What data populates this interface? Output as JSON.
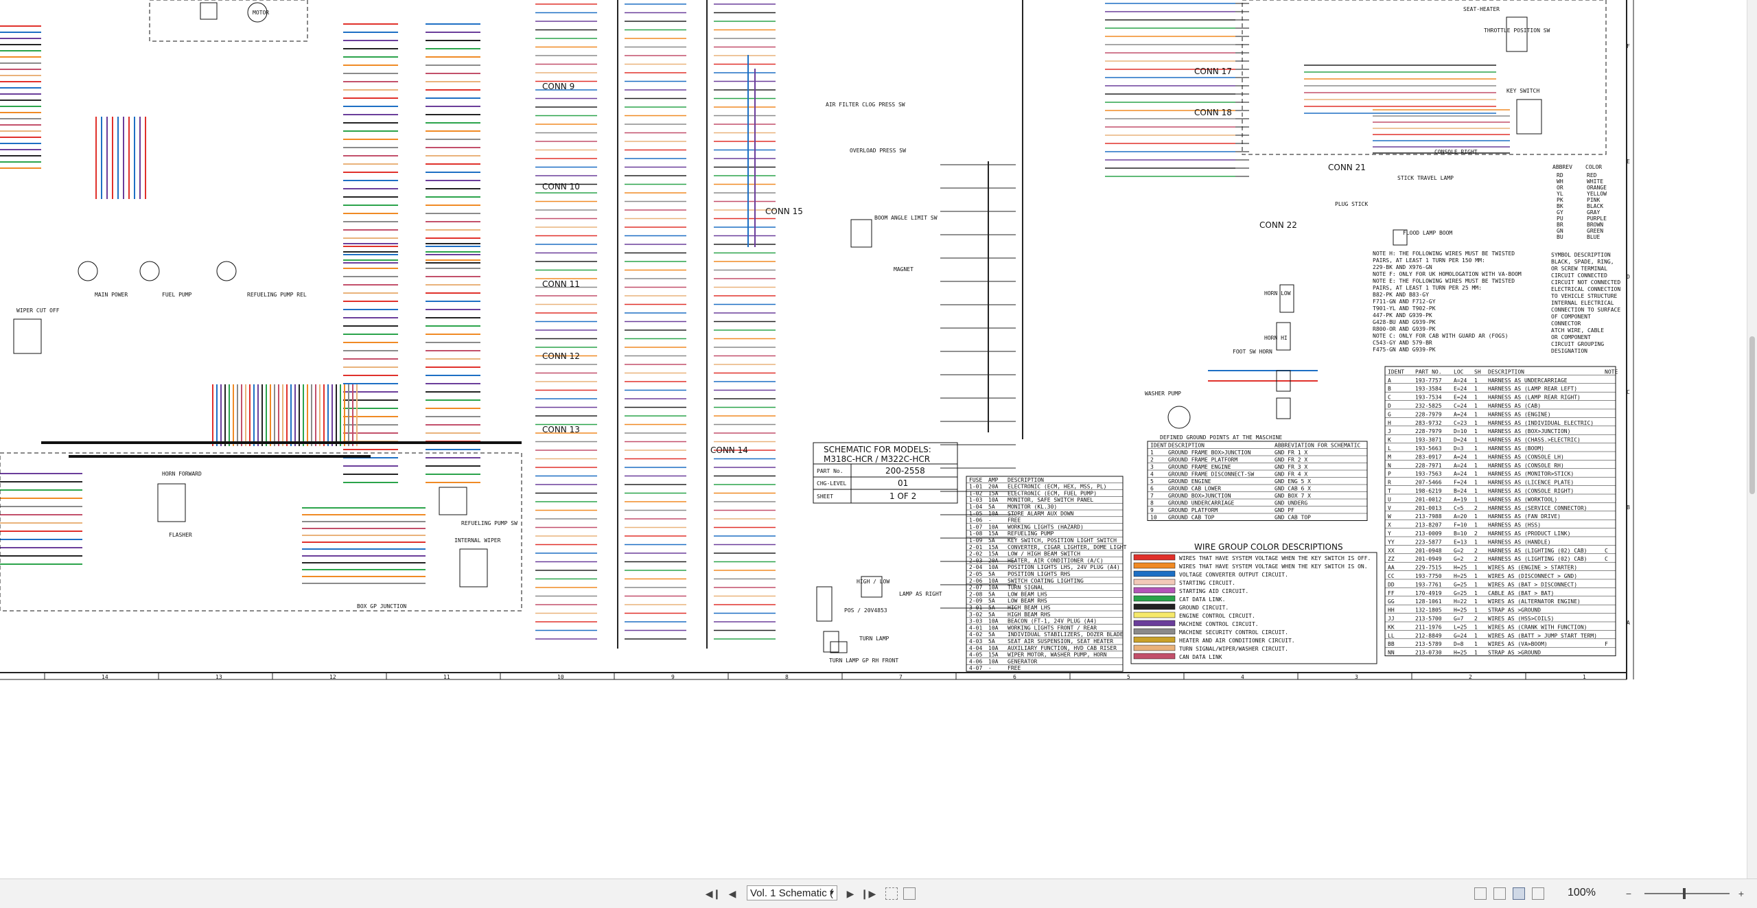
{
  "document": {
    "title_block": {
      "heading_line1": "SCHEMATIC FOR MODELS:",
      "heading_line2": "M318C-HCR / M322C-HCR",
      "part_no_label": "PART No.",
      "part_no": "200-2558",
      "chg_level_label": "CHG-LEVEL",
      "chg_level": "01",
      "sheet_label": "SHEET",
      "sheet": "1 OF 2"
    },
    "connectors": [
      "CONN 9",
      "CONN 10",
      "CONN 11",
      "CONN 12",
      "CONN 13",
      "CONN 14",
      "CONN 15",
      "CONN 17",
      "CONN 18",
      "CONN 21",
      "CONN 22"
    ],
    "component_labels": {
      "motor": "MOTOR",
      "seat_heater": "SEAT-HEATER",
      "console_right": "CONSOLE RIGHT",
      "key_switch": "KEY SWITCH",
      "throttle": "THROTTLE POSITION SW",
      "air_filter": "AIR FILTER CLOG PRESS SW",
      "overload": "OVERLOAD PRESS SW",
      "boom_angle": "BOOM ANGLE LIMIT SW",
      "magnet": "MAGNET",
      "stick_travel": "STICK TRAVEL LAMP",
      "plug_stick": "PLUG STICK",
      "flood_lamp": "FLOOD LAMP BOOM",
      "horn_low": "HORN LOW",
      "horn_hi": "HORN HI",
      "foot_sw_horn": "FOOT SW HORN",
      "washer_pump": "WASHER PUMP",
      "high_low": "HIGH / LOW",
      "lamp_as_right": "LAMP AS RIGHT",
      "pos": "POS / 20V4853",
      "turn_lamp": "TURN LAMP",
      "turn_lamp_gp": "TURN LAMP GP RH FRONT",
      "wiper_cut_off": "WIPER CUT OFF",
      "main_power": "MAIN POWER",
      "fuel_pump": "FUEL PUMP",
      "refuel_pump": "REFUELING PUMP REL",
      "horn_forward": "HORN FORWARD",
      "flasher": "FLASHER",
      "refuel_pump_sw": "REFUELING PUMP SW",
      "internal_wiper": "INTERNAL WIPER",
      "box_gp": "BOX GP JUNCTION"
    },
    "notes": [
      "NOTE H: THE FOLLOWING WIRES MUST BE TWISTED",
      "PAIRS, AT LEAST 1 TURN PER 150 MM:",
      "229-BK AND X976-GN",
      "NOTE F: ONLY FOR UK HOMOLOGATION WITH VA-BOOM",
      "NOTE E: THE FOLLOWING WIRES MUST BE TWISTED",
      "PAIRS, AT LEAST 1 TURN PER 25 MM:",
      "B82-PK AND B83-GY",
      "F711-GN AND F712-GY",
      "T901-YL AND T902-PK",
      "447-PK AND G939-PK",
      "G428-BU AND G939-PK",
      "R800-OR AND G939-PK",
      "NOTE C: ONLY FOR CAB WITH GUARD AR (FOGS)",
      "C543-GY AND 579-BR",
      "F475-GN AND G939-PK"
    ],
    "abbrev": {
      "header_abbrev": "ABBREV",
      "header_color": "COLOR",
      "rows": [
        [
          "RD",
          "RED"
        ],
        [
          "WH",
          "WHITE"
        ],
        [
          "OR",
          "ORANGE"
        ],
        [
          "YL",
          "YELLOW"
        ],
        [
          "PK",
          "PINK"
        ],
        [
          "BK",
          "BLACK"
        ],
        [
          "GY",
          "GRAY"
        ],
        [
          "PU",
          "PURPLE"
        ],
        [
          "BR",
          "BROWN"
        ],
        [
          "GN",
          "GREEN"
        ],
        [
          "BU",
          "BLUE"
        ]
      ]
    },
    "symbols": [
      "SYMBOL   DESCRIPTION",
      "BLACK, SPADE, RING,",
      "OR SCREW TERMINAL",
      "CIRCUIT CONNECTED",
      "CIRCUIT NOT CONNECTED",
      "ELECTRICAL CONNECTION",
      "TO VEHICLE STRUCTURE",
      "INTERNAL ELECTRICAL",
      "CONNECTION TO SURFACE",
      "OF COMPONENT",
      "CONNECTOR",
      "ATCH WIRE, CABLE",
      "OR COMPONENT",
      "CIRCUIT GROUPING",
      "DESIGNATION"
    ],
    "ground_points": {
      "title": "DEFINED GROUND POINTS AT THE MASCHINE",
      "headers": [
        "IDENT",
        "DESCRIPTION",
        "ABBREVIATION FOR SCHEMATIC"
      ],
      "rows": [
        [
          "1",
          "GROUND FRAME BOX>JUNCTION",
          "GND FR 1 X"
        ],
        [
          "2",
          "GROUND FRAME PLATFORM",
          "GND FR 2 X"
        ],
        [
          "3",
          "GROUND FRAME ENGINE",
          "GND FR 3 X"
        ],
        [
          "4",
          "GROUND FRAME DISCONNECT-SW",
          "GND FR 4 X"
        ],
        [
          "5",
          "GROUND ENGINE",
          "GND ENG 5 X"
        ],
        [
          "6",
          "GROUND CAB LOWER",
          "GND CAB 6 X"
        ],
        [
          "7",
          "GROUND BOX>JUNCTION",
          "GND BOX 7 X"
        ],
        [
          "8",
          "GROUND UNDERCARRIAGE",
          "GND UNDERG"
        ],
        [
          "9",
          "GROUND PLATFORM",
          "GND PF"
        ],
        [
          "10",
          "GROUND CAB TOP",
          "GND CAB TOP"
        ]
      ]
    },
    "fuse_table": {
      "headers": [
        "FUSE",
        "AMP",
        "DESCRIPTION"
      ],
      "rows": [
        [
          "1-01",
          "20A",
          "ELECTRONIC (ECM, HEX, MSS, PL)"
        ],
        [
          "1-02",
          "15A",
          "ELECTRONIC (ECM, FUEL PUMP)"
        ],
        [
          "1-03",
          "10A",
          "MONITOR, SAFE SWITCH PANEL"
        ],
        [
          "1-04",
          "5A",
          "MONITOR (KL.30)"
        ],
        [
          "1-05",
          "10A",
          "STORE ALARM AUX DOWN"
        ],
        [
          "1-06",
          "-",
          "FREE"
        ],
        [
          "1-07",
          "10A",
          "WORKING LIGHTS (HAZARD)"
        ],
        [
          "1-08",
          "15A",
          "REFUELING PUMP"
        ],
        [
          "1-09",
          "5A",
          "KEY SWITCH, POSITION LIGHT SWITCH"
        ],
        [
          "2-01",
          "15A",
          "CONVERTER, CIGAR LIGHTER, DOME LIGHT"
        ],
        [
          "2-02",
          "15A",
          "LOW / HIGH BEAM SWITCH"
        ],
        [
          "2-03",
          "20A",
          "HEATER, AIR CONDITIONER (A/C)"
        ],
        [
          "2-04",
          "10A",
          "POSITION LIGHTS LHS, 24V PLUG (A4)"
        ],
        [
          "2-05",
          "5A",
          "POSITION LIGHTS RHS"
        ],
        [
          "2-06",
          "10A",
          "SWITCH COATING LIGHTING"
        ],
        [
          "2-07",
          "10A",
          "TURN SIGNAL"
        ],
        [
          "2-08",
          "5A",
          "LOW BEAM LHS"
        ],
        [
          "2-09",
          "5A",
          "LOW BEAM RHS"
        ],
        [
          "3-01",
          "5A",
          "HIGH BEAM LHS"
        ],
        [
          "3-02",
          "5A",
          "HIGH BEAM RHS"
        ],
        [
          "3-03",
          "10A",
          "BEACON (FT-1, 24V PLUG (A4)"
        ],
        [
          "4-01",
          "10A",
          "WORKING LIGHTS FRONT / REAR"
        ],
        [
          "4-02",
          "5A",
          "INDIVIDUAL STABILIZERS, DOZER BLADE"
        ],
        [
          "4-03",
          "5A",
          "SEAT AIR SUSPENSION, SEAT HEATER"
        ],
        [
          "4-04",
          "10A",
          "AUXILIARY FUNCTION, HVD CAB RISER"
        ],
        [
          "4-05",
          "15A",
          "WIPER MOTOR, WASHER PUMP, HORN"
        ],
        [
          "4-06",
          "10A",
          "GENERATOR"
        ],
        [
          "4-07",
          "-",
          "FREE"
        ]
      ]
    },
    "wire_colors": {
      "title": "WIRE GROUP COLOR DESCRIPTIONS",
      "rows": [
        {
          "color": "#e0302a",
          "text": "WIRES THAT HAVE SYSTEM VOLTAGE WHEN THE KEY SWITCH IS OFF."
        },
        {
          "color": "#f08a24",
          "text": "WIRES THAT HAVE SYSTEM VOLTAGE WHEN THE KEY SWITCH IS ON."
        },
        {
          "color": "#1d6fc4",
          "text": "VOLTAGE CONVERTER OUTPUT CIRCUIT."
        },
        {
          "color": "#f2c9b8",
          "text": "STARTING CIRCUIT."
        },
        {
          "color": "#b455b8",
          "text": "STARTING AID CIRCUIT."
        },
        {
          "color": "#2aa34a",
          "text": "CAT DATA LINK."
        },
        {
          "color": "#222222",
          "text": "GROUND CIRCUIT."
        },
        {
          "color": "#f6e96a",
          "text": "ENGINE CONTROL CIRCUIT."
        },
        {
          "color": "#6a3d9a",
          "text": "MACHINE CONTROL CIRCUIT."
        },
        {
          "color": "#8a8a8a",
          "text": "MACHINE SECURITY CONTROL CIRCUIT."
        },
        {
          "color": "#c9a12a",
          "text": "HEATER AND AIR CONDITIONER CIRCUIT."
        },
        {
          "color": "#e9b27a",
          "text": "TURN SIGNAL/WIPER/WASHER CIRCUIT."
        },
        {
          "color": "#c24f6a",
          "text": "CAN DATA LINK"
        }
      ]
    },
    "harness_table": {
      "headers": [
        "IDENT",
        "PART NO.",
        "LOC",
        "SH",
        "DESCRIPTION",
        "NOTE"
      ],
      "rows": [
        [
          "A",
          "193-7757",
          "A=24",
          "1",
          "HARNESS AS UNDERCARRIAGE",
          ""
        ],
        [
          "B",
          "193-3584",
          "E=24",
          "1",
          "HARNESS AS (LAMP REAR LEFT)",
          ""
        ],
        [
          "C",
          "193-7534",
          "E=24",
          "1",
          "HARNESS AS (LAMP REAR RIGHT)",
          ""
        ],
        [
          "D",
          "232-5825",
          "C=24",
          "1",
          "HARNESS AS (CAB)",
          ""
        ],
        [
          "G",
          "228-7979",
          "A=24",
          "1",
          "HARNESS AS (ENGINE)",
          ""
        ],
        [
          "H",
          "283-9732",
          "C=23",
          "1",
          "HARNESS AS (INDIVIDUAL ELECTRIC)",
          ""
        ],
        [
          "J",
          "228-7979",
          "D=10",
          "1",
          "HARNESS AS (BOX>JUNCTION)",
          ""
        ],
        [
          "K",
          "193-3071",
          "D=24",
          "1",
          "HARNESS AS (CHASS.>ELECTRIC)",
          ""
        ],
        [
          "L",
          "193-5663",
          "D=3",
          "1",
          "HARNESS AS (BOOM)",
          ""
        ],
        [
          "M",
          "283-0917",
          "A=24",
          "1",
          "HARNESS AS (CONSOLE LH)",
          ""
        ],
        [
          "N",
          "228-7971",
          "A=24",
          "1",
          "HARNESS AS (CONSOLE RH)",
          ""
        ],
        [
          "P",
          "193-7563",
          "A=24",
          "1",
          "HARNESS AS (MONITOR>STICK)",
          ""
        ],
        [
          "R",
          "207-5466",
          "F=24",
          "1",
          "HARNESS AS (LICENCE PLATE)",
          ""
        ],
        [
          "T",
          "198-6219",
          "B=24",
          "1",
          "HARNESS AS (CONSOLE RIGHT)",
          ""
        ],
        [
          "U",
          "201-0012",
          "A=19",
          "1",
          "HARNESS AS (WORKTOOL)",
          ""
        ],
        [
          "V",
          "201-0013",
          "C=5",
          "2",
          "HARNESS AS (SERVICE CONNECTOR)",
          ""
        ],
        [
          "W",
          "213-7988",
          "A=20",
          "1",
          "HARNESS AS (FAN DRIVE)",
          ""
        ],
        [
          "X",
          "213-8207",
          "F=10",
          "1",
          "HARNESS AS (HSS)",
          ""
        ],
        [
          "Y",
          "213-0009",
          "B=10",
          "2",
          "HARNESS AS (PRODUCT LINK)",
          ""
        ],
        [
          "YY",
          "223-5877",
          "E=13",
          "1",
          "HARNESS AS (HANDLE)",
          ""
        ],
        [
          "XX",
          "201-0948",
          "G=2",
          "2",
          "HARNESS AS (LIGHTING (02) CAB)",
          "C"
        ],
        [
          "ZZ",
          "201-0949",
          "G=2",
          "2",
          "HARNESS AS (LIGHTING (02) CAB)",
          "C"
        ],
        [
          "AA",
          "229-7515",
          "H=25",
          "1",
          "WIRES AS (ENGINE > STARTER)",
          ""
        ],
        [
          "CC",
          "193-7750",
          "H=25",
          "1",
          "WIRES AS (DISCONNECT > GND)",
          ""
        ],
        [
          "DD",
          "193-7761",
          "G=25",
          "1",
          "WIRES AS (BAT > DISCONNECT)",
          ""
        ],
        [
          "FF",
          "170-4919",
          "G=25",
          "1",
          "CABLE AS (BAT > BAT)",
          ""
        ],
        [
          "GG",
          "128-1061",
          "H=22",
          "1",
          "WIRES AS (ALTERNATOR ENGINE)",
          ""
        ],
        [
          "HH",
          "132-1805",
          "H=25",
          "1",
          "STRAP AS >GROUND",
          ""
        ],
        [
          "JJ",
          "213-5700",
          "G=7",
          "2",
          "WIRES AS (HSS>COILS)",
          ""
        ],
        [
          "KK",
          "211-1976",
          "L=25",
          "1",
          "WIRES AS (CRANK WITH FUNCTION)",
          ""
        ],
        [
          "LL",
          "212-8849",
          "G=24",
          "1",
          "WIRES AS (BATT > JUMP START TERM)",
          ""
        ],
        [
          "BB",
          "213-5789",
          "D=8",
          "1",
          "WIRES AS (VA>BOOM)",
          "F"
        ],
        [
          "NN",
          "213-0730",
          "H=25",
          "1",
          "STRAP AS >GROUND",
          ""
        ]
      ]
    },
    "grid_columns": [
      "14",
      "13",
      "12",
      "11",
      "10",
      "9",
      "8",
      "7",
      "6",
      "5",
      "4",
      "3",
      "2",
      "1"
    ],
    "grid_rows": [
      "F",
      "E",
      "D",
      "C",
      "B",
      "A"
    ]
  },
  "toolbar": {
    "page_select_value": "Vol. 1 Schematic (",
    "zoom": "100%",
    "icons": {
      "first": "first-page-icon",
      "prev": "previous-page-icon",
      "next": "next-page-icon",
      "last": "last-page-icon"
    }
  }
}
